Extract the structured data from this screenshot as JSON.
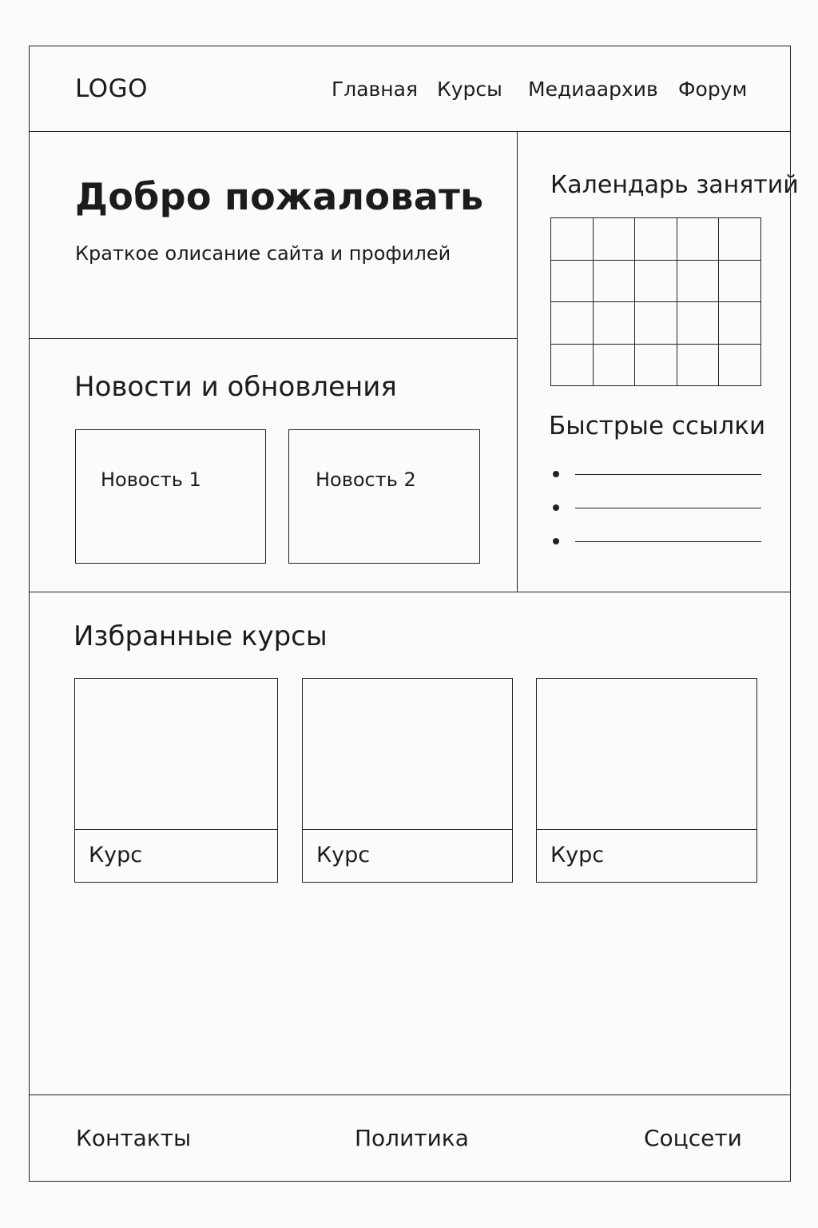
{
  "header": {
    "logo": "LOGO",
    "nav": [
      "Главная",
      "Курсы",
      "Медиаархив",
      "Форум"
    ]
  },
  "welcome": {
    "title": "Добро пожаловать",
    "description": "Краткое олисание сайта и профилей"
  },
  "news": {
    "title": "Новости и обновления",
    "items": [
      "Новость 1",
      "Новость 2"
    ]
  },
  "sidebar": {
    "calendar_title": "Календарь занятий",
    "calendar_grid": {
      "columns": 5,
      "rows": 4
    },
    "quick_links_title": "Быстрые ссылки",
    "quick_links_count": 3
  },
  "featured": {
    "title": "Избранные курсы",
    "courses": [
      "Курс",
      "Курс",
      "Курс"
    ]
  },
  "footer": {
    "links": [
      "Контакты",
      "Политика",
      "Соцсети"
    ]
  }
}
